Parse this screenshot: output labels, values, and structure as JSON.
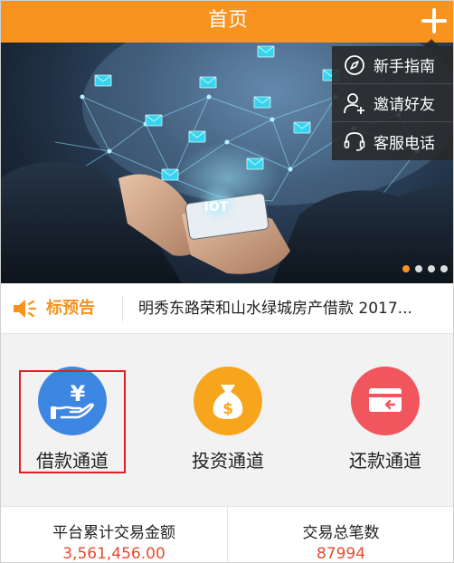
{
  "header": {
    "title": "首页"
  },
  "menu": {
    "items": [
      {
        "label": "新手指南",
        "icon": "compass-icon"
      },
      {
        "label": "邀请好友",
        "icon": "add-user-icon"
      },
      {
        "label": "客服电话",
        "icon": "headset-icon"
      }
    ]
  },
  "banner": {
    "overlay_text": "IOT",
    "slide_count": 4,
    "active_slide": 1
  },
  "notice": {
    "label": "标预告",
    "text": "明秀东路荣和山水绿城房产借款 2017...",
    "icon": "speaker-icon"
  },
  "channels": [
    {
      "label": "借款通道",
      "icon": "yen-hand-icon",
      "color": "#3d87e3"
    },
    {
      "label": "投资通道",
      "icon": "money-bag-icon",
      "color": "#f7a51d"
    },
    {
      "label": "还款通道",
      "icon": "card-return-icon",
      "color": "#f1555e"
    }
  ],
  "stats": [
    {
      "title": "平台累计交易金额",
      "value": "3,561,456.00"
    },
    {
      "title": "交易总笔数",
      "value": "87994"
    }
  ],
  "colors": {
    "accent": "#f7931e",
    "value_red": "#e8492f",
    "highlight": "#e02020"
  }
}
